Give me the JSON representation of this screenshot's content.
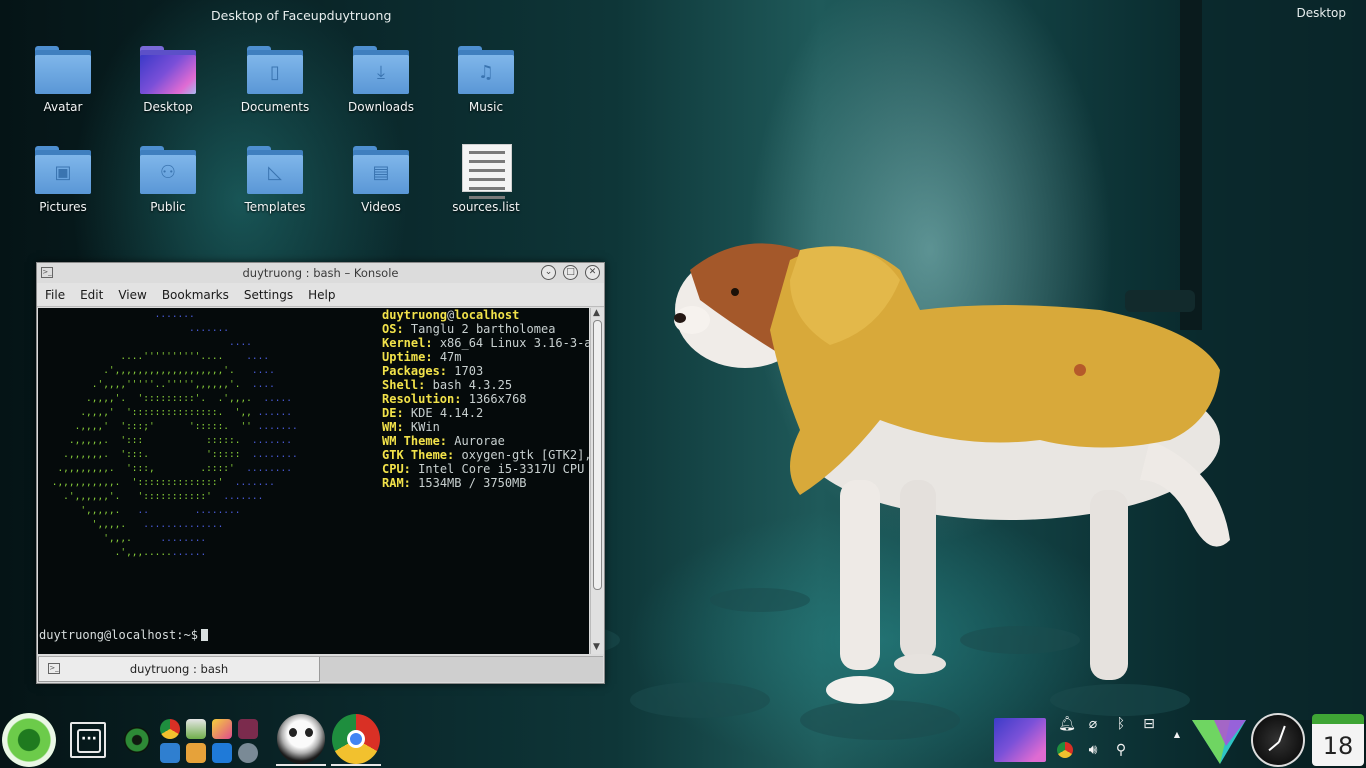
{
  "desktop": {
    "folderview_title": "Desktop of Faceupduytruong",
    "corner_label": "Desktop",
    "icons": [
      {
        "label": "Avatar",
        "icon": "folder-icon"
      },
      {
        "label": "Desktop",
        "icon": "desktop-folder-icon"
      },
      {
        "label": "Documents",
        "icon": "documents-folder-icon"
      },
      {
        "label": "Downloads",
        "icon": "downloads-folder-icon"
      },
      {
        "label": "Music",
        "icon": "music-folder-icon"
      },
      {
        "label": "Pictures",
        "icon": "pictures-folder-icon"
      },
      {
        "label": "Public",
        "icon": "public-folder-icon"
      },
      {
        "label": "Templates",
        "icon": "templates-folder-icon"
      },
      {
        "label": "Videos",
        "icon": "videos-folder-icon"
      },
      {
        "label": "sources.list",
        "icon": "text-file-icon"
      }
    ]
  },
  "konsole": {
    "title": "duytruong : bash – Konsole",
    "menu": [
      "File",
      "Edit",
      "View",
      "Bookmarks",
      "Settings",
      "Help"
    ],
    "tab_label": "duytruong : bash",
    "prompt": "duytruong@localhost:~$",
    "info_header": {
      "user": "duytruong",
      "at": "@",
      "host": "localhost"
    },
    "info": [
      {
        "key": "OS:",
        "value": "Tanglu 2 bartholomea"
      },
      {
        "key": "Kernel:",
        "value": "x86_64 Linux 3.16-3-a"
      },
      {
        "key": "Uptime:",
        "value": "47m"
      },
      {
        "key": "Packages:",
        "value": "1703"
      },
      {
        "key": "Shell:",
        "value": "bash 4.3.25"
      },
      {
        "key": "Resolution:",
        "value": "1366x768"
      },
      {
        "key": "DE:",
        "value": "KDE 4.14.2"
      },
      {
        "key": "WM:",
        "value": "KWin"
      },
      {
        "key": "WM Theme:",
        "value": "Aurorae"
      },
      {
        "key": "GTK Theme:",
        "value": "oxygen-gtk [GTK2],"
      },
      {
        "key": "CPU:",
        "value": "Intel Core i5-3317U CPU"
      },
      {
        "key": "RAM:",
        "value": "1534MB / 3750MB"
      }
    ]
  },
  "panel": {
    "launcher_icon": "kickoff-launcher-icon",
    "pager_icon": "activities-icon",
    "quick_launch": [
      "chromium-icon",
      "file-manager-icon",
      "photo-viewer-icon",
      "media-icon",
      "finder-icon",
      "game-icon",
      "store-icon",
      "settings-icon"
    ],
    "tasks": [
      "skull-app-icon",
      "chrome-icon"
    ],
    "tray": [
      "notifications-icon",
      "attachment-icon",
      "bluetooth-icon",
      "network-icon",
      "chrome-tray-icon",
      "volume-icon",
      "usb-icon"
    ],
    "calendar_day": "18"
  },
  "colors": {
    "konsole_key": "#f2e24a",
    "art_green": "#8ad03a",
    "art_blue": "#4b5cdb"
  }
}
